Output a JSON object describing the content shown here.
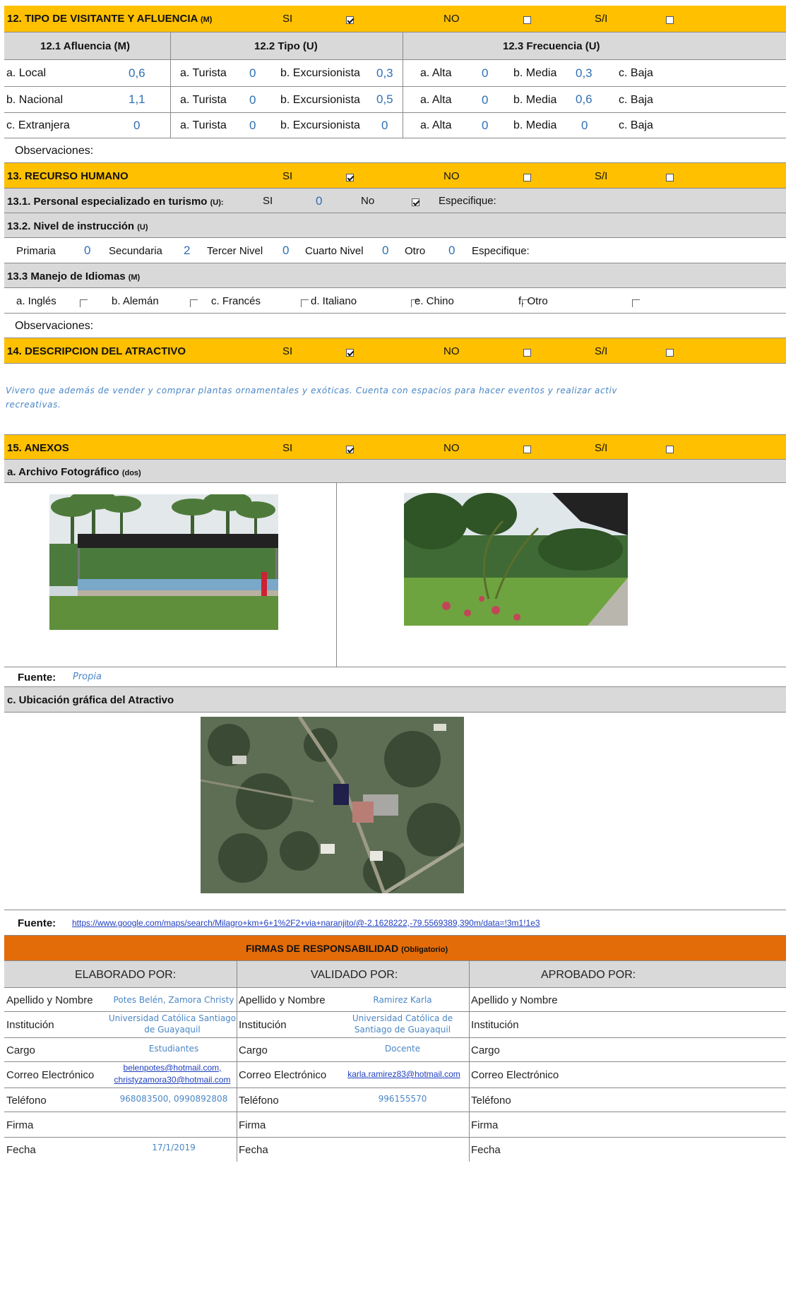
{
  "s12": {
    "title": "12. TIPO DE VISITANTE Y AFLUENCIA",
    "tag": "(M)",
    "si": "SI",
    "no": "NO",
    "si_label_ni": "S/I",
    "col_afluencia": "12.1 Afluencia (M)",
    "col_tipo": "12.2 Tipo (U)",
    "col_frecuencia": "12.3 Frecuencia (U)",
    "rows": [
      {
        "name": "a. Local",
        "afl": "0,6",
        "tur_label": "a. Turista",
        "tur": "0",
        "exc_label": "b. Excursionista",
        "exc": "0,3",
        "alta_label": "a. Alta",
        "alta": "0",
        "media_label": "b. Media",
        "media": "0,3",
        "baja_label": "c. Baja"
      },
      {
        "name": "b. Nacional",
        "afl": "1,1",
        "tur_label": "a. Turista",
        "tur": "0",
        "exc_label": "b. Excursionista",
        "exc": "0,5",
        "alta_label": "a. Alta",
        "alta": "0",
        "media_label": "b. Media",
        "media": "0,6",
        "baja_label": "c. Baja"
      },
      {
        "name": "c. Extranjera",
        "afl": "0",
        "tur_label": "a. Turista",
        "tur": "0",
        "exc_label": "b. Excursionista",
        "exc": "0",
        "alta_label": "a. Alta",
        "alta": "0",
        "media_label": "b. Media",
        "media": "0",
        "baja_label": "c. Baja"
      }
    ],
    "observaciones": "Observaciones:"
  },
  "s13": {
    "title": "13. RECURSO HUMANO",
    "si": "SI",
    "no": "NO",
    "si_label_ni": "S/I",
    "p131": "13.1. Personal especializado en turismo",
    "p131_tag": "(U):",
    "p131_si": "SI",
    "p131_si_val": "0",
    "p131_no": "No",
    "p131_esp": "Especifique:",
    "p132": "13.2. Nivel de instrucción",
    "p132_tag": "(U)",
    "niveles": [
      {
        "label": "Primaria",
        "val": "0"
      },
      {
        "label": "Secundaria",
        "val": "2"
      },
      {
        "label": "Tercer Nivel",
        "val": "0"
      },
      {
        "label": "Cuarto Nivel",
        "val": "0"
      },
      {
        "label": "Otro",
        "val": "0"
      }
    ],
    "niveles_esp": "Especifique:",
    "p133": "13.3 Manejo de Idiomas",
    "p133_tag": "(M)",
    "idiomas": [
      "a. Inglés",
      "b. Alemán",
      "c. Francés",
      "d. Italiano",
      "e. Chino",
      "f. Otro"
    ],
    "observaciones": "Observaciones:"
  },
  "s14": {
    "title": "14. DESCRIPCION DEL ATRACTIVO",
    "si": "SI",
    "no": "NO",
    "si_label_ni": "S/I",
    "text_line1": "Vivero que además de vender y comprar plantas ornamentales y exóticas. Cuenta con espacios para hacer eventos y realizar activ",
    "text_line2": "recreativas."
  },
  "s15": {
    "title": "15. ANEXOS",
    "si": "SI",
    "no": "NO",
    "si_label_ni": "S/I",
    "archivo": "a. Archivo Fotográfico",
    "archivo_tag": "(dos)",
    "fuente_label": "Fuente:",
    "fuente_foto": "Propia",
    "ubicacion": "c. Ubicación gráfica del Atractivo",
    "fuente_mapa": "https://www.google.com/maps/search/Milagro+km+6+1%2F2+via+naranjito/@-2.1628222,-79.5569389,390m/data=!3m1!1e3"
  },
  "firmas": {
    "title": "FIRMAS DE RESPONSABILIDAD",
    "title_tag": "(Obligatorio)",
    "cols": [
      "ELABORADO POR:",
      "VALIDADO  POR:",
      "APROBADO POR:"
    ],
    "labels": [
      "Apellido y Nombre",
      "Institución",
      "Cargo",
      "Correo Electrónico",
      "Teléfono",
      "Firma",
      "Fecha"
    ],
    "elaborado": {
      "nombre": "Potes Belén, Zamora Christy",
      "inst1": "Universidad Católica Santiago",
      "inst2": "de Guayaquil",
      "cargo": "Estudiantes",
      "correo1": "belenpotes@hotmail.com,",
      "correo2": "christyzamora30@hotmail.com",
      "telefono": "968083500, 0990892808",
      "fecha": "17/1/2019"
    },
    "validado": {
      "nombre": "Ramirez Karla",
      "inst1": "Universidad Católica de",
      "inst2": "Santiago de Guayaquil",
      "cargo": "Docente",
      "correo": "karla.ramirez83@hotmail.com",
      "telefono": "996155570"
    }
  },
  "colors": {
    "section": "#ffc000",
    "subsection": "#d9d9d9",
    "firmas": "#e36c09",
    "handwritten": "#4a86c5",
    "values": "#2f6fb5"
  }
}
